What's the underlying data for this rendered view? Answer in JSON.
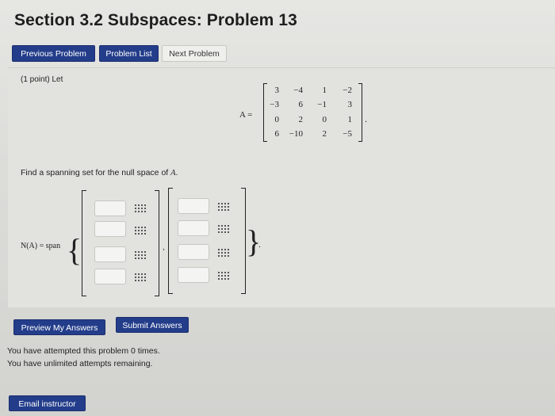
{
  "page": {
    "title": "Section 3.2 Subspaces: Problem 13"
  },
  "nav": {
    "previous_label": "Previous Problem",
    "list_label": "Problem List",
    "next_label": "Next Problem"
  },
  "problem": {
    "points_label": "(1 point) Let",
    "matrix_label": "A =",
    "matrix": [
      [
        "3",
        "−4",
        "1",
        "−2"
      ],
      [
        "−3",
        "6",
        "−1",
        "3"
      ],
      [
        "0",
        "2",
        "0",
        "1"
      ],
      [
        "6",
        "−10",
        "2",
        "−5"
      ]
    ],
    "prompt_text": "Find a spanning set for the null space of",
    "prompt_var": "A",
    "prompt_end": ".",
    "span_label": "N(A) = span",
    "vectors": [
      [
        "",
        "",
        "",
        ""
      ],
      [
        "",
        "",
        "",
        ""
      ]
    ]
  },
  "actions": {
    "preview_label": "Preview My Answers",
    "submit_label": "Submit Answers",
    "email_label": "Email instructor"
  },
  "status": {
    "attempted": "You have attempted this problem 0 times.",
    "remaining": "You have unlimited attempts remaining."
  },
  "colors": {
    "primary_button": "#233d8a",
    "background": "#dcdcd9"
  }
}
